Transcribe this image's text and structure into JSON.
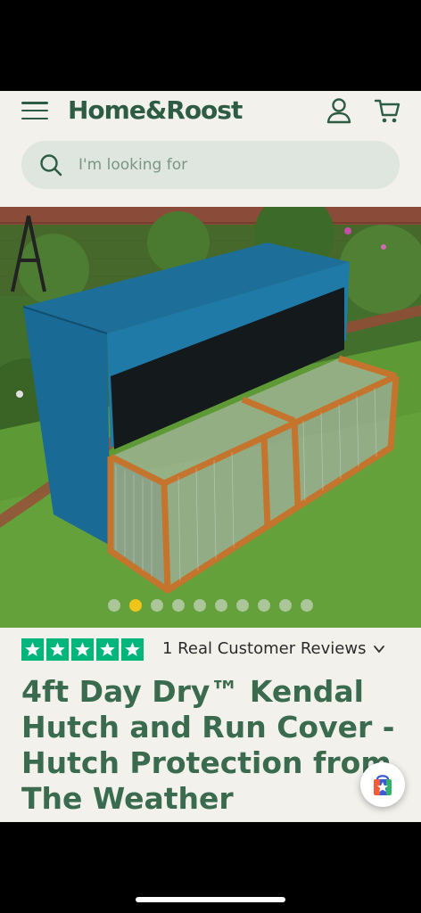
{
  "header": {
    "logo": "Home&Roost",
    "search_placeholder": "I'm looking for"
  },
  "gallery": {
    "image_count": 10,
    "active_index": 1
  },
  "product": {
    "rating": {
      "stars": 5,
      "review_text": "1 Real Customer Reviews"
    },
    "title": "4ft Day Dry™ Kendal Hutch and Run Cover - Hutch Protection from The Weather"
  },
  "colors": {
    "brand_green": "#2e5c43",
    "title_green": "#3b6b4f",
    "trustpilot_green": "#00b67a",
    "active_dot": "#f0c419"
  },
  "icons": {
    "menu": "hamburger-menu-icon",
    "account": "account-icon",
    "cart": "cart-icon",
    "search": "search-icon",
    "expand": "chevron-down-icon",
    "fab": "shopping-bag-star-icon"
  }
}
